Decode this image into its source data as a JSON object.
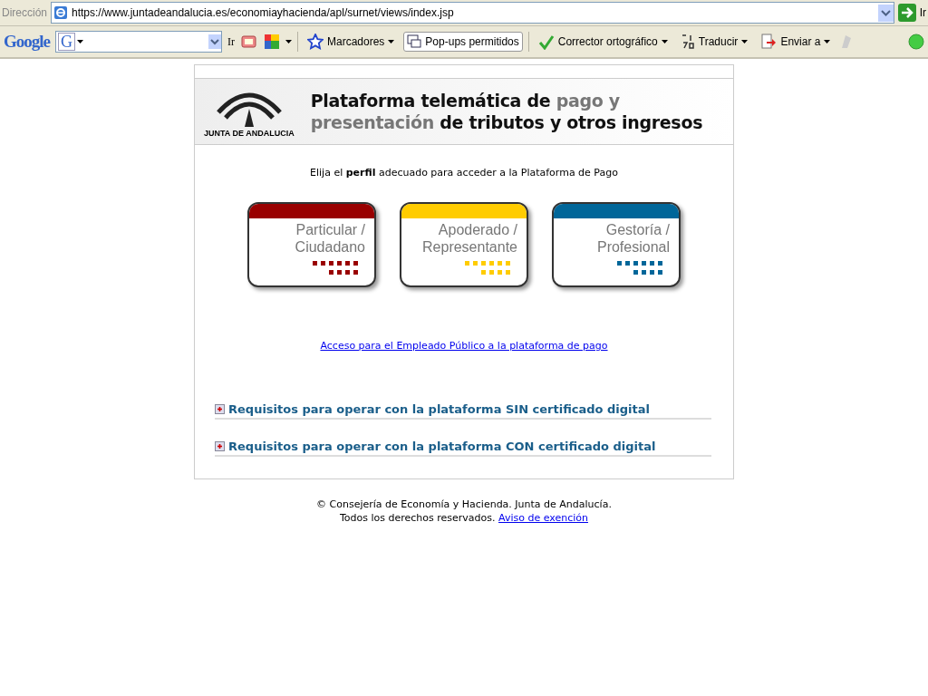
{
  "address_bar": {
    "label": "Dirección",
    "url": "https://www.juntadeandalucia.es/economiayhacienda/apl/surnet/views/index.jsp",
    "go": "Ir"
  },
  "toolbar": {
    "logo": "Google",
    "search_logo": "G",
    "go": "Ir",
    "bookmarks": "Marcadores",
    "popups": "Pop-ups permitidos",
    "spellcheck": "Corrector ortográfico",
    "translate": "Traducir",
    "send": "Enviar a"
  },
  "header": {
    "logo_text": "JUNTA DE ANDALUCIA",
    "title_lines": [
      "Plataforma telemática de *pago y*",
      "*presentación* de tributos y otros ingresos"
    ]
  },
  "intro": "Elija el **perfil** adecuado para acceder a la Plataforma de Pago",
  "profiles": [
    {
      "line1": "Particular /",
      "line2": "Ciudadano",
      "color": "#990000"
    },
    {
      "line1": "Apoderado /",
      "line2": "Representante",
      "color": "#ffcc00"
    },
    {
      "line1": "Gestoría /",
      "line2": "Profesional",
      "color": "#006699"
    }
  ],
  "employee_link": "Acceso para el Empleado Público a la plataforma de pago",
  "sections": [
    {
      "title": "Requisitos para operar con la plataforma SIN certificado digital",
      "expanded": false
    },
    {
      "title": "Requisitos para operar con la plataforma CON certificado digital",
      "expanded": false
    }
  ],
  "footer": {
    "copyright": "© Consejería de Economía y Hacienda. Junta de Andalucía.",
    "rights": "Todos los derechos reservados.",
    "link": "Aviso de exención"
  }
}
